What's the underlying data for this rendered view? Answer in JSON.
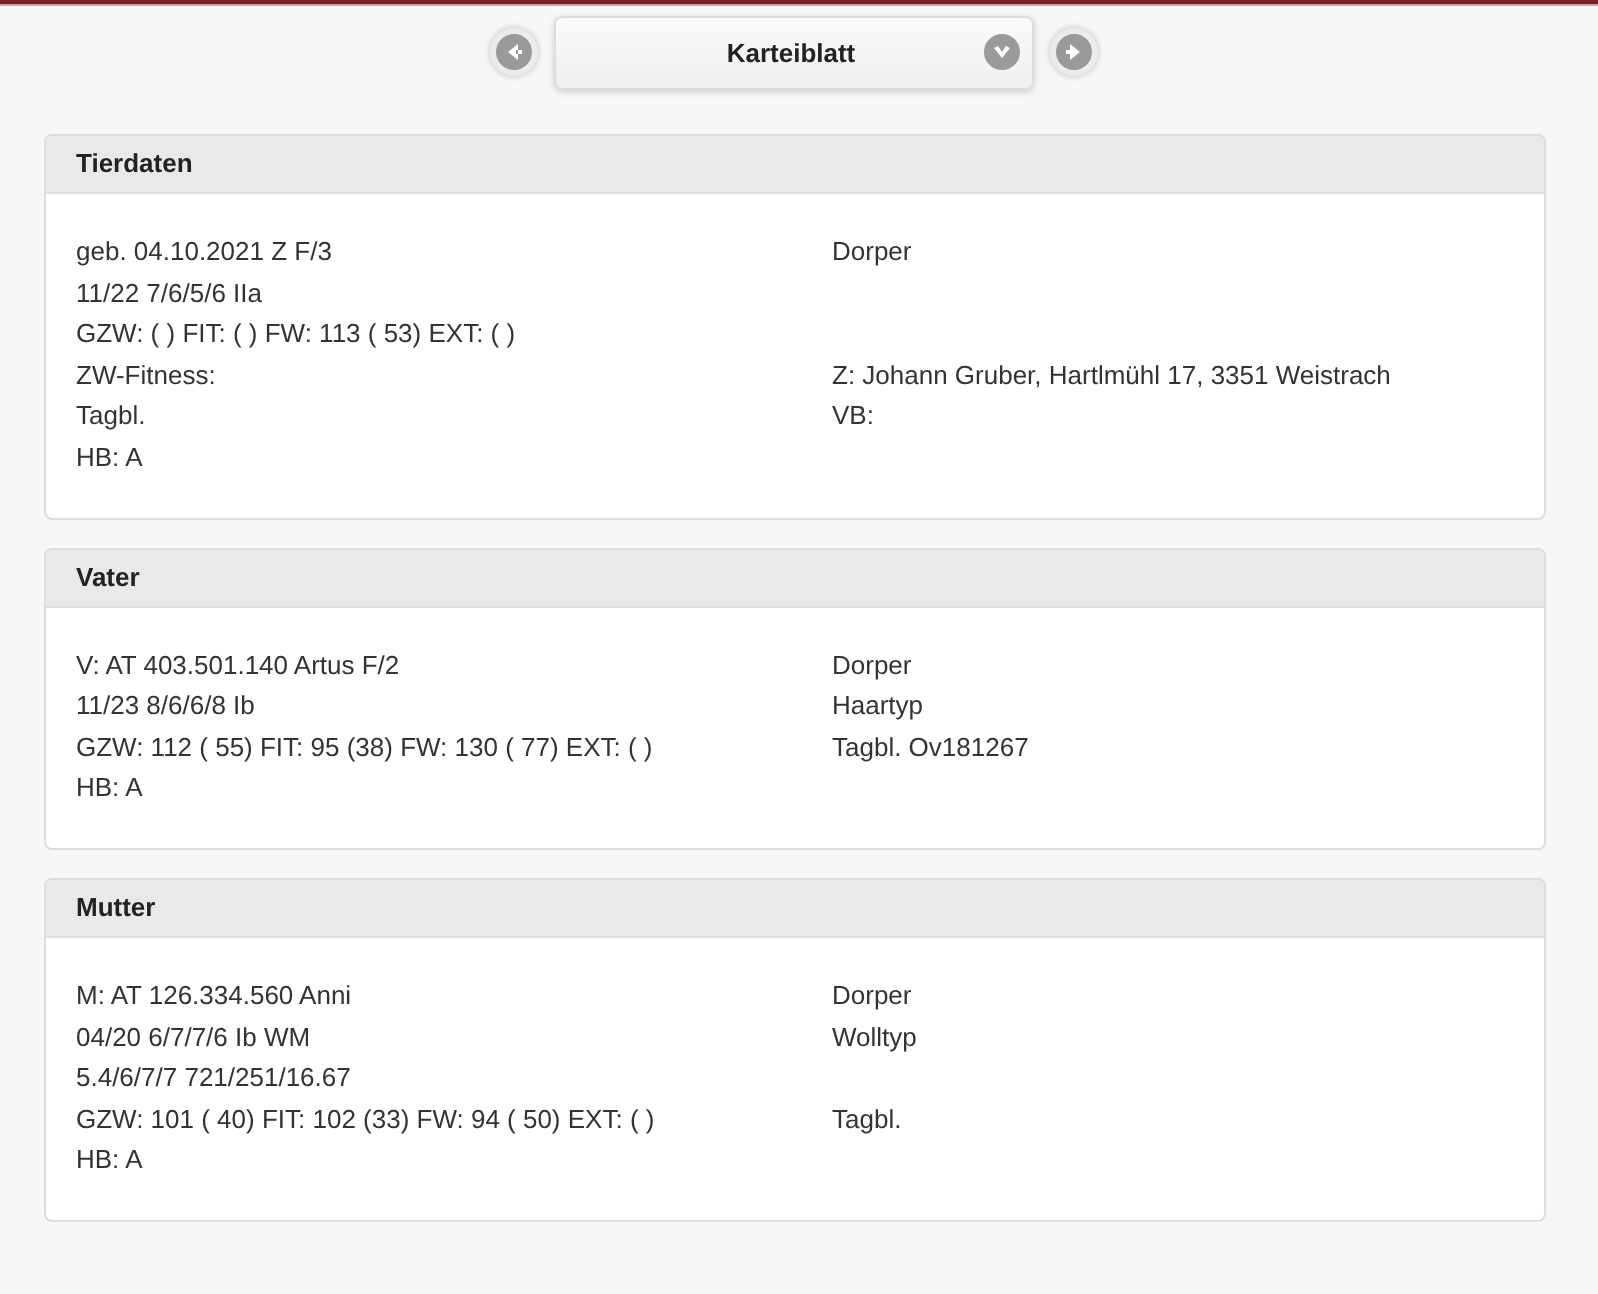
{
  "navigation": {
    "title": "Karteiblatt"
  },
  "sections": [
    {
      "title": "Tierdaten",
      "rows": [
        {
          "left": "geb. 04.10.2021 Z F/3",
          "right": "Dorper"
        },
        {
          "left": "11/22 7/6/5/6 IIa"
        },
        {
          "left": "GZW: ( ) FIT: ( ) FW: 113 ( 53) EXT: ( )"
        },
        {
          "left": "ZW-Fitness:",
          "right": "Z: Johann Gruber, Hartlmühl 17, 3351 Weistrach"
        },
        {
          "left": "Tagbl.",
          "right": "VB:"
        },
        {
          "left": "HB: A"
        }
      ]
    },
    {
      "title": "Vater",
      "rows": [
        {
          "left": "V: AT 403.501.140 Artus F/2",
          "right": "Dorper"
        },
        {
          "left": "11/23 8/6/6/8 Ib",
          "right": "Haartyp"
        },
        {
          "left": "GZW: 112 ( 55) FIT: 95 (38) FW: 130 ( 77) EXT: ( )",
          "right": "Tagbl. Ov181267"
        },
        {
          "left": "HB: A"
        }
      ]
    },
    {
      "title": "Mutter",
      "rows": [
        {
          "left": "M: AT 126.334.560 Anni",
          "right": "Dorper"
        },
        {
          "left": "04/20 6/7/7/6 Ib WM",
          "right": "Wolltyp"
        },
        {
          "left": "5.4/6/7/7 721/251/16.67"
        },
        {
          "left": "GZW: 101 ( 40) FIT: 102 (33) FW: 94 ( 50) EXT: ( )",
          "right": "Tagbl."
        },
        {
          "left": "HB: A"
        }
      ]
    }
  ]
}
